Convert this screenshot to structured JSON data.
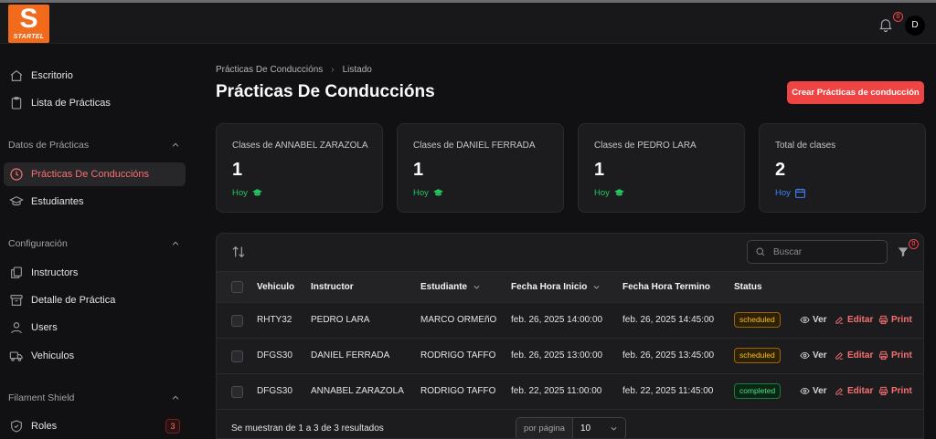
{
  "brand": {
    "logo_letter": "S",
    "logo_text": "STARTEL",
    "accent": "#ef4444",
    "logo_color": "#f26b1d"
  },
  "topbar": {
    "notifications_count": "0",
    "avatar_initial": "D"
  },
  "sidebar": {
    "items_top": [
      {
        "label": "Escritorio",
        "icon": "home-icon"
      },
      {
        "label": "Lista de Prácticas",
        "icon": "clipboard-icon"
      }
    ],
    "groups": [
      {
        "label": "Datos de Prácticas",
        "items": [
          {
            "label": "Prácticas De Conduccións",
            "icon": "clock-icon",
            "active": true
          },
          {
            "label": "Estudiantes",
            "icon": "academic-cap-icon"
          }
        ]
      },
      {
        "label": "Configuración",
        "items": [
          {
            "label": "Instructors",
            "icon": "document-duplicate-icon"
          },
          {
            "label": "Detalle de Práctica",
            "icon": "archive-box-icon"
          },
          {
            "label": "Users",
            "icon": "user-icon"
          },
          {
            "label": "Vehiculos",
            "icon": "truck-icon"
          }
        ]
      },
      {
        "label": "Filament Shield",
        "items": [
          {
            "label": "Roles",
            "icon": "shield-check-icon",
            "badge": "3"
          }
        ]
      }
    ]
  },
  "header": {
    "breadcrumb": [
      "Prácticas De Conduccións",
      "Listado"
    ],
    "title": "Prácticas De Conduccións",
    "create_label": "Crear Prácticas de conducción"
  },
  "stats": [
    {
      "label": "Clases de ANNABEL ZARAZOLA",
      "value": "1",
      "desc": "Hoy",
      "color": "#22c55e",
      "icon": "academic-cap-icon"
    },
    {
      "label": "Clases de DANIEL FERRADA",
      "value": "1",
      "desc": "Hoy",
      "color": "#22c55e",
      "icon": "academic-cap-icon"
    },
    {
      "label": "Clases de PEDRO LARA",
      "value": "1",
      "desc": "Hoy",
      "color": "#22c55e",
      "icon": "academic-cap-icon"
    },
    {
      "label": "Total de clases",
      "value": "2",
      "desc": "Hoy",
      "color": "#3b82f6",
      "icon": "calendar-icon"
    }
  ],
  "table": {
    "search_placeholder": "Buscar",
    "filter_count": "0",
    "columns": [
      "Vehiculo",
      "Instructor",
      "Estudiante",
      "Fecha Hora Inicio",
      "Fecha Hora Termino",
      "Status"
    ],
    "rows": [
      {
        "vehiculo": "RHTY32",
        "instructor": "PEDRO LARA",
        "estudiante": "MARCO ORMEñO",
        "inicio": "feb. 26, 2025 14:00:00",
        "termino": "feb. 26, 2025 14:45:00",
        "status": "scheduled"
      },
      {
        "vehiculo": "DFGS30",
        "instructor": "DANIEL FERRADA",
        "estudiante": "RODRIGO TAFFO",
        "inicio": "feb. 26, 2025 13:00:00",
        "termino": "feb. 26, 2025 13:45:00",
        "status": "scheduled"
      },
      {
        "vehiculo": "DFGS30",
        "instructor": "ANNABEL ZARAZOLA",
        "estudiante": "RODRIGO TAFFO",
        "inicio": "feb. 22, 2025 11:00:00",
        "termino": "feb. 22, 2025 11:45:00",
        "status": "completed"
      }
    ],
    "actions": {
      "view": "Ver",
      "edit": "Editar",
      "print": "Print"
    },
    "footer": {
      "results": "Se muestran de 1 a 3 de 3 resultados",
      "per_page_label": "por página",
      "per_page_value": "10"
    }
  }
}
